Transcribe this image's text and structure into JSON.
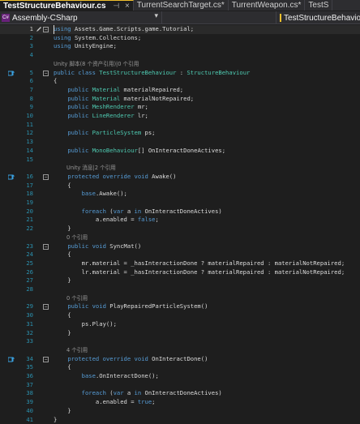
{
  "tabs": [
    {
      "label": "TestStructureBehaviour.cs",
      "active": true,
      "pin": "⊣",
      "close": "×"
    },
    {
      "label": "TurrentSearchTarget.cs*",
      "active": false
    },
    {
      "label": "TurrentWeapon.cs*",
      "active": false
    },
    {
      "label": "TestS",
      "active": false
    }
  ],
  "nav": {
    "project": "Assembly-CSharp",
    "member": "TestStructureBehaviour"
  },
  "lines": [
    {
      "n": "1",
      "segs": [
        [
          "k",
          "using"
        ],
        [
          "s",
          " Assets.Game.Scripts.game.Tutorial;"
        ]
      ]
    },
    {
      "n": "2",
      "segs": [
        [
          "k",
          "using"
        ],
        [
          "s",
          " System.Collections;"
        ]
      ]
    },
    {
      "n": "3",
      "segs": [
        [
          "k",
          "using"
        ],
        [
          "s",
          " UnityEngine;"
        ]
      ]
    },
    {
      "n": "4",
      "segs": []
    },
    {
      "note": "Unity 脚本(8 个资产引用)|0 个引用"
    },
    {
      "n": "5",
      "segs": [
        [
          "k",
          "public class "
        ],
        [
          "t",
          "TestStructureBehaviour"
        ],
        [
          "s",
          " : "
        ],
        [
          "t",
          "StructureBehaviour"
        ]
      ]
    },
    {
      "n": "6",
      "segs": [
        [
          "s",
          "{"
        ]
      ]
    },
    {
      "n": "7",
      "segs": [
        [
          "s",
          "    "
        ],
        [
          "k",
          "public "
        ],
        [
          "t",
          "Material"
        ],
        [
          "s",
          " materialRepaired;"
        ]
      ]
    },
    {
      "n": "8",
      "segs": [
        [
          "s",
          "    "
        ],
        [
          "k",
          "public "
        ],
        [
          "t",
          "Material"
        ],
        [
          "s",
          " materialNotRepaired;"
        ]
      ]
    },
    {
      "n": "9",
      "segs": [
        [
          "s",
          "    "
        ],
        [
          "k",
          "public "
        ],
        [
          "t",
          "MeshRenderer"
        ],
        [
          "s",
          " mr;"
        ]
      ]
    },
    {
      "n": "10",
      "segs": [
        [
          "s",
          "    "
        ],
        [
          "k",
          "public "
        ],
        [
          "t",
          "LineRenderer"
        ],
        [
          "s",
          " lr;"
        ]
      ]
    },
    {
      "n": "11",
      "segs": []
    },
    {
      "n": "12",
      "segs": [
        [
          "s",
          "    "
        ],
        [
          "k",
          "public "
        ],
        [
          "t",
          "ParticleSystem"
        ],
        [
          "s",
          " ps;"
        ]
      ]
    },
    {
      "n": "13",
      "segs": []
    },
    {
      "n": "14",
      "segs": [
        [
          "s",
          "    "
        ],
        [
          "k",
          "public "
        ],
        [
          "t",
          "MonoBehaviour"
        ],
        [
          "s",
          "[] OnInteractDoneActives;"
        ]
      ]
    },
    {
      "n": "15",
      "segs": []
    },
    {
      "note": "Unity 消息|2 个引用"
    },
    {
      "n": "16",
      "segs": [
        [
          "s",
          "    "
        ],
        [
          "k",
          "protected override void "
        ],
        [
          "s",
          "Awake()"
        ]
      ]
    },
    {
      "n": "17",
      "segs": [
        [
          "s",
          "    {"
        ]
      ]
    },
    {
      "n": "18",
      "segs": [
        [
          "s",
          "        "
        ],
        [
          "k",
          "base"
        ],
        [
          "s",
          ".Awake();"
        ]
      ]
    },
    {
      "n": "19",
      "segs": []
    },
    {
      "n": "20",
      "segs": [
        [
          "s",
          "        "
        ],
        [
          "k",
          "foreach"
        ],
        [
          "s",
          " ("
        ],
        [
          "k",
          "var"
        ],
        [
          "s",
          " a "
        ],
        [
          "k",
          "in"
        ],
        [
          "s",
          " OnInteractDoneActives)"
        ]
      ]
    },
    {
      "n": "21",
      "segs": [
        [
          "s",
          "            a.enabled = "
        ],
        [
          "k",
          "false"
        ],
        [
          "s",
          ";"
        ]
      ]
    },
    {
      "n": "22",
      "segs": [
        [
          "s",
          "    }"
        ]
      ]
    },
    {
      "note": "0 个引用"
    },
    {
      "n": "23",
      "segs": [
        [
          "s",
          "    "
        ],
        [
          "k",
          "public void "
        ],
        [
          "s",
          "SyncMat()"
        ]
      ]
    },
    {
      "n": "24",
      "segs": [
        [
          "s",
          "    {"
        ]
      ]
    },
    {
      "n": "25",
      "segs": [
        [
          "s",
          "        mr.material = _hasInteractionDone ? materialRepaired : materialNotRepaired;"
        ]
      ]
    },
    {
      "n": "26",
      "segs": [
        [
          "s",
          "        lr.material = _hasInteractionDone ? materialRepaired : materialNotRepaired;"
        ]
      ]
    },
    {
      "n": "27",
      "segs": [
        [
          "s",
          "    }"
        ]
      ]
    },
    {
      "n": "28",
      "segs": []
    },
    {
      "note": "0 个引用"
    },
    {
      "n": "29",
      "segs": [
        [
          "s",
          "    "
        ],
        [
          "k",
          "public void "
        ],
        [
          "s",
          "PlayRepairedParticleSystem()"
        ]
      ]
    },
    {
      "n": "30",
      "segs": [
        [
          "s",
          "    {"
        ]
      ]
    },
    {
      "n": "31",
      "segs": [
        [
          "s",
          "        ps.Play();"
        ]
      ]
    },
    {
      "n": "32",
      "segs": [
        [
          "s",
          "    }"
        ]
      ]
    },
    {
      "n": "33",
      "segs": []
    },
    {
      "note": "4 个引用"
    },
    {
      "n": "34",
      "segs": [
        [
          "s",
          "    "
        ],
        [
          "k",
          "protected override void "
        ],
        [
          "s",
          "OnInteractDone()"
        ]
      ]
    },
    {
      "n": "35",
      "segs": [
        [
          "s",
          "    {"
        ]
      ]
    },
    {
      "n": "36",
      "segs": [
        [
          "s",
          "        "
        ],
        [
          "k",
          "base"
        ],
        [
          "s",
          ".OnInteractDone();"
        ]
      ]
    },
    {
      "n": "37",
      "segs": []
    },
    {
      "n": "38",
      "segs": [
        [
          "s",
          "        "
        ],
        [
          "k",
          "foreach"
        ],
        [
          "s",
          " ("
        ],
        [
          "k",
          "var"
        ],
        [
          "s",
          " a "
        ],
        [
          "k",
          "in"
        ],
        [
          "s",
          " OnInteractDoneActives)"
        ]
      ]
    },
    {
      "n": "39",
      "segs": [
        [
          "s",
          "            a.enabled = "
        ],
        [
          "k",
          "true"
        ],
        [
          "s",
          ";"
        ]
      ]
    },
    {
      "n": "40",
      "segs": [
        [
          "s",
          "    }"
        ]
      ]
    },
    {
      "n": "41",
      "segs": [
        [
          "s",
          "}"
        ]
      ]
    }
  ],
  "colors": {
    "keyword": "#569cd6",
    "type": "#4ec9b0",
    "text": "#dcdcdc",
    "line_number": "#2b91af",
    "background": "#1e1e1e",
    "active_tab_accent": "#f0c02c"
  },
  "icons": {
    "edit": "pencil-icon",
    "override_marker": "override-up-arrow-icon",
    "project": "csharp-project-icon",
    "class": "class-icon"
  }
}
